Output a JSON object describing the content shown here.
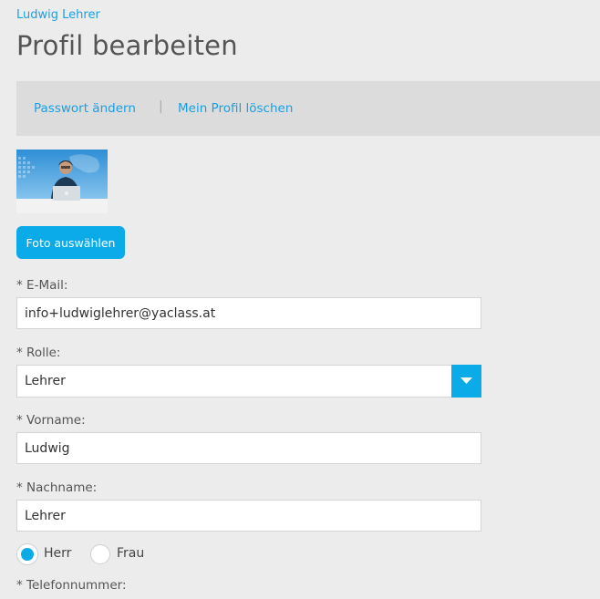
{
  "breadcrumb": "Ludwig Lehrer",
  "page_title": "Profil bearbeiten",
  "actions": {
    "change_password": "Passwort ändern",
    "separator": "|",
    "delete_profile": "Mein Profil löschen"
  },
  "photo_button": "Foto auswählen",
  "form": {
    "email_label": "* E-Mail:",
    "email_value": "info+ludwiglehrer@yaclass.at",
    "role_label": "* Rolle:",
    "role_value": "Lehrer",
    "firstname_label": "* Vorname:",
    "firstname_value": "Ludwig",
    "lastname_label": "* Nachname:",
    "lastname_value": "Lehrer",
    "gender_options": [
      "Herr",
      "Frau"
    ],
    "gender_selected": "Herr",
    "phone_label": "* Telefonnummer:"
  },
  "colors": {
    "accent": "#0aabe8",
    "link": "#1aa0e3",
    "background": "#ececec"
  },
  "icons": [
    "profile-photo",
    "chevron-down-icon"
  ]
}
